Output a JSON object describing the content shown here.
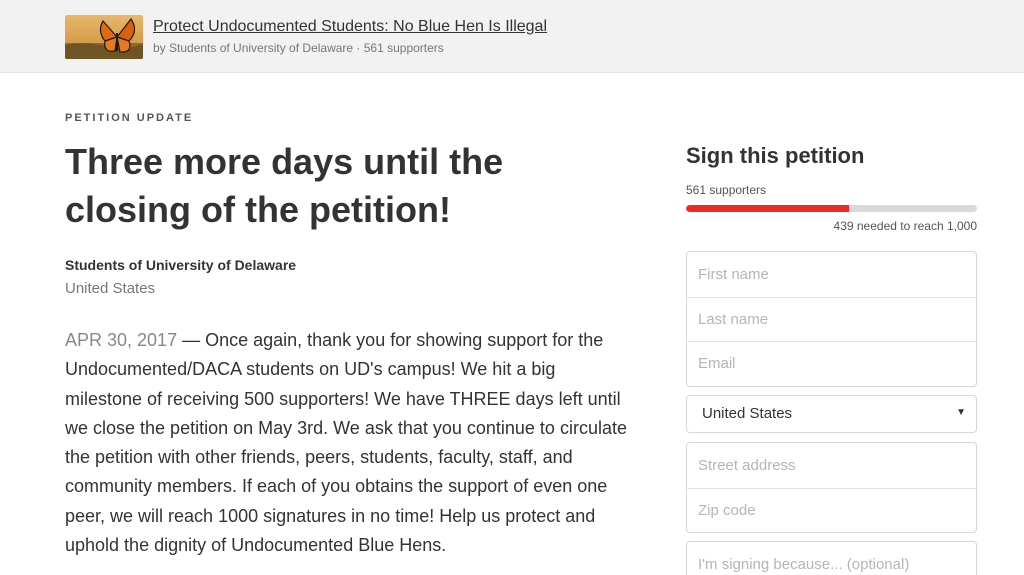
{
  "header": {
    "title": "Protect Undocumented Students: No Blue Hen Is Illegal",
    "byline": "by Students of University of Delaware · 561 supporters",
    "thumbnail_icon": "butterfly-on-field-image"
  },
  "update": {
    "eyebrow": "PETITION UPDATE",
    "title": "Three more days until the closing of the petition!",
    "author": "Students of University of Delaware",
    "country": "United States",
    "date": "APR 30, 2017",
    "body": " — Once again, thank you for showing support for the Undocumented/DACA students on UD's campus! We hit a big milestone of receiving 500 supporters! We have THREE days left until we close the petition on May 3rd. We ask that you continue to circulate the petition with other friends, peers, students, faculty, staff, and community members. If each of you obtains the support of even one peer, we will reach 1000 signatures in no time! Help us protect and uphold the dignity of Undocumented Blue Hens."
  },
  "sign": {
    "title": "Sign this petition",
    "supporters": "561 supporters",
    "progress_fraction": 0.561,
    "needed": "439 needed to reach 1,000",
    "first_name_placeholder": "First name",
    "last_name_placeholder": "Last name",
    "email_placeholder": "Email",
    "country_value": "United States",
    "street_placeholder": "Street address",
    "zip_placeholder": "Zip code",
    "reason_placeholder": "I'm signing because... (optional)"
  },
  "colors": {
    "progress_fill": "#ec2c22",
    "progress_track": "#d9d9d9",
    "header_bg": "#f2f2f2"
  }
}
